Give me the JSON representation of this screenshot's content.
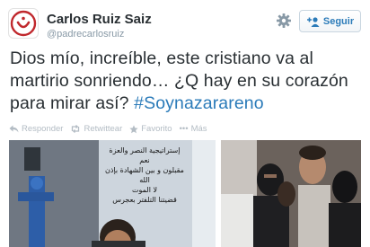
{
  "user": {
    "name": "Carlos Ruiz Saiz",
    "handle": "@padrecarlosruiz",
    "avatar_glyph": "ن"
  },
  "follow_button": {
    "label": "Seguir",
    "icon": "add-user-icon"
  },
  "settings_icon": "gear-icon",
  "tweet": {
    "text": "Dios mío, increíble, este cristiano va al martirio sonriendo… ¿Q hay en su corazón para mirar así?",
    "hashtag": "#Soynazarareno"
  },
  "actions": {
    "reply": "Responder",
    "retweet": "Retwittear",
    "favorite": "Favorito",
    "more": "Más"
  },
  "photos": {
    "left_sign_lines": [
      "إستراتيجية النصر والعزة",
      "نعم",
      "مقبلون و بين الشهادة بإذن الله",
      "لا الموت",
      "قضيتنا التلفتر بعجرس"
    ]
  },
  "colors": {
    "link": "#2b7bb9",
    "text": "#292f33",
    "muted": "#8899a6",
    "avatar_red": "#c0282d"
  }
}
